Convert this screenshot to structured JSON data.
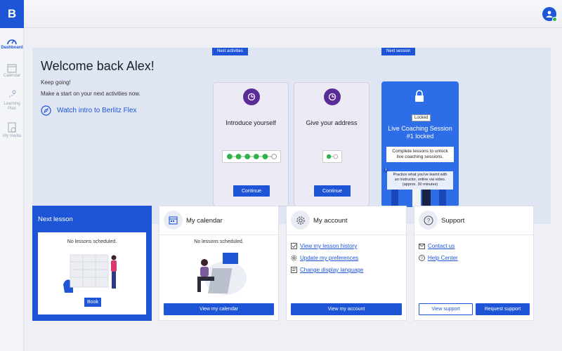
{
  "app": {
    "logo_letter": "B",
    "accent": "#1e55d6"
  },
  "sidebar": {
    "items": [
      {
        "label": "Dashboard",
        "icon": "gauge-icon",
        "active": true
      },
      {
        "label": "Calendar",
        "icon": "calendar-icon"
      },
      {
        "label": "Learning\nPlan",
        "icon": "learning-path-icon"
      },
      {
        "label": "My media",
        "icon": "media-icon"
      }
    ]
  },
  "welcome": {
    "title": "Welcome back Alex!",
    "line1": "Keep going!",
    "line2": "Make a start on your next activities now.",
    "watch_link": "Watch intro to Berlitz Flex"
  },
  "next_activities": {
    "tag": "Next activities",
    "cards": [
      {
        "title": "Introduce yourself",
        "button": "Continue",
        "progress_done": 5,
        "progress_total": 6
      },
      {
        "title": "Give your address",
        "button": "Continue",
        "progress_done": 1,
        "progress_total": 2
      }
    ]
  },
  "next_session": {
    "tag": "Next session",
    "badge": "Locked",
    "title_line1": "Live Coaching Session",
    "title_line2": "#1 locked",
    "box1_line1": "Complete lessons to unlock",
    "box1_line2": "live coaching sessions.",
    "box2_line1": "Practice what you've learnt with",
    "box2_line2": "an instructor, online via video.",
    "box2_line3": "(approx. 30 minutes)"
  },
  "next_lesson": {
    "title": "Next lesson",
    "empty": "No lessons scheduled.",
    "button": "Book"
  },
  "calendar": {
    "title": "My calendar",
    "empty": "No lessons scheduled.",
    "button": "View my calendar"
  },
  "account": {
    "title": "My account",
    "links": [
      "View my lesson history",
      "Update my preferences",
      "Change display language"
    ],
    "button": "View my account"
  },
  "support": {
    "title": "Support",
    "links": [
      "Contact us",
      "Help Center"
    ],
    "button_view": "View support",
    "button_request": "Request support"
  }
}
